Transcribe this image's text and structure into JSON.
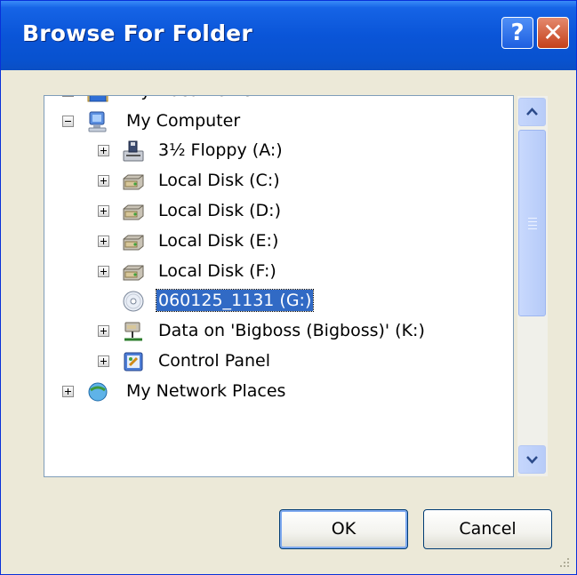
{
  "window": {
    "title": "Browse For Folder",
    "help_glyph": "?",
    "close_glyph": "✕"
  },
  "tree": {
    "items": [
      {
        "label": "My Documents",
        "icon": "my-documents-icon",
        "expander": "plus",
        "selected": false
      },
      {
        "label": "My Computer",
        "icon": "my-computer-icon",
        "expander": "minus",
        "selected": false
      },
      {
        "label": "3½ Floppy (A:)",
        "icon": "floppy-drive-icon",
        "expander": "plus",
        "selected": false
      },
      {
        "label": "Local Disk (C:)",
        "icon": "hard-disk-icon",
        "expander": "plus",
        "selected": false
      },
      {
        "label": "Local Disk (D:)",
        "icon": "hard-disk-icon",
        "expander": "plus",
        "selected": false
      },
      {
        "label": "Local Disk (E:)",
        "icon": "hard-disk-icon",
        "expander": "plus",
        "selected": false
      },
      {
        "label": "Local Disk (F:)",
        "icon": "hard-disk-icon",
        "expander": "plus",
        "selected": false
      },
      {
        "label": "060125_1131 (G:)",
        "icon": "cd-drive-icon",
        "expander": "none",
        "selected": true
      },
      {
        "label": "Data on 'Bigboss (Bigboss)' (K:)",
        "icon": "network-drive-icon",
        "expander": "plus",
        "selected": false
      },
      {
        "label": "Control Panel",
        "icon": "control-panel-icon",
        "expander": "plus",
        "selected": false
      },
      {
        "label": "My Network Places",
        "icon": "network-places-icon",
        "expander": "plus",
        "selected": false
      }
    ]
  },
  "buttons": {
    "ok": "OK",
    "cancel": "Cancel"
  },
  "colors": {
    "titlebar": "#0a55d8",
    "selection": "#316ac5",
    "face": "#ece9d8"
  }
}
